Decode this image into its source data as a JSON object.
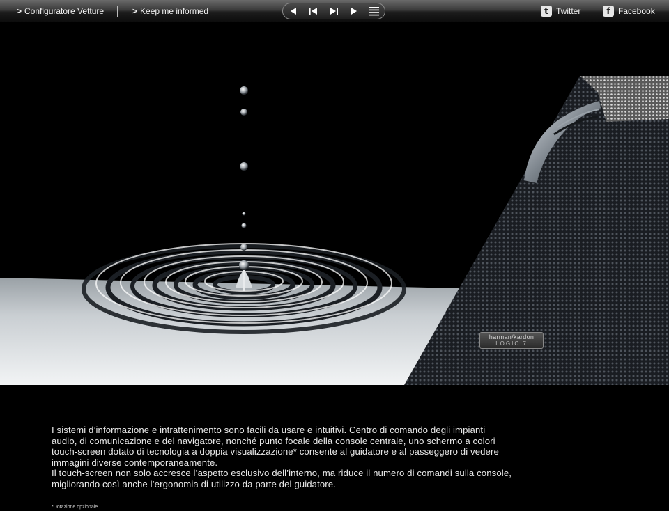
{
  "topbar": {
    "link1": {
      "arrow": ">",
      "label": "Configuratore Vetture"
    },
    "link2": {
      "arrow": ">",
      "label": "Keep me informed"
    },
    "nav": {
      "prev_icon": "arrow-left-icon",
      "first_icon": "skip-start-icon",
      "last_icon": "skip-end-icon",
      "next_icon": "arrow-right-icon",
      "menu_icon": "menu-icon"
    },
    "twitter": {
      "icon_glyph": "t",
      "label": "Twitter"
    },
    "facebook": {
      "icon_glyph": "f",
      "label": "Facebook"
    }
  },
  "hero": {
    "badge_line1": "harman/kardon",
    "badge_line2": "LOGIC 7"
  },
  "content": {
    "paragraph1": "I sistemi d’informazione e intrattenimento sono facili da usare e intuitivi. Centro di comando degli impianti audio, di comunicazione e del navigatore, nonché punto focale della console centrale, uno schermo a colori touch-screen dotato di tecnologia a doppia visualizzazione* consente al guidatore e al passeggero di vedere immagini diverse contemporaneamente.",
    "paragraph2": "Il touch-screen non solo accresce l’aspetto esclusivo dell’interno, ma riduce il numero di comandi sulla console, migliorando così anche l’ergonomia di utilizzo da parte del guidatore.",
    "footnote": "*Dotazione opzionale"
  },
  "colors": {
    "background": "#000000",
    "topbar": "#2a2a2a",
    "text": "#e8e8e8"
  }
}
